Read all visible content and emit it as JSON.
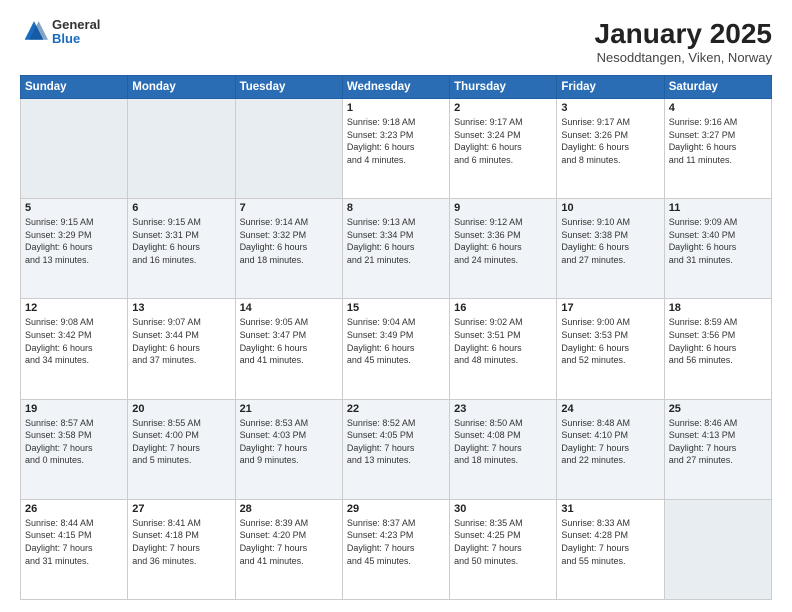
{
  "logo": {
    "general": "General",
    "blue": "Blue"
  },
  "title": "January 2025",
  "subtitle": "Nesoddtangen, Viken, Norway",
  "days_of_week": [
    "Sunday",
    "Monday",
    "Tuesday",
    "Wednesday",
    "Thursday",
    "Friday",
    "Saturday"
  ],
  "weeks": [
    [
      {
        "day": "",
        "info": ""
      },
      {
        "day": "",
        "info": ""
      },
      {
        "day": "",
        "info": ""
      },
      {
        "day": "1",
        "info": "Sunrise: 9:18 AM\nSunset: 3:23 PM\nDaylight: 6 hours\nand 4 minutes."
      },
      {
        "day": "2",
        "info": "Sunrise: 9:17 AM\nSunset: 3:24 PM\nDaylight: 6 hours\nand 6 minutes."
      },
      {
        "day": "3",
        "info": "Sunrise: 9:17 AM\nSunset: 3:26 PM\nDaylight: 6 hours\nand 8 minutes."
      },
      {
        "day": "4",
        "info": "Sunrise: 9:16 AM\nSunset: 3:27 PM\nDaylight: 6 hours\nand 11 minutes."
      }
    ],
    [
      {
        "day": "5",
        "info": "Sunrise: 9:15 AM\nSunset: 3:29 PM\nDaylight: 6 hours\nand 13 minutes."
      },
      {
        "day": "6",
        "info": "Sunrise: 9:15 AM\nSunset: 3:31 PM\nDaylight: 6 hours\nand 16 minutes."
      },
      {
        "day": "7",
        "info": "Sunrise: 9:14 AM\nSunset: 3:32 PM\nDaylight: 6 hours\nand 18 minutes."
      },
      {
        "day": "8",
        "info": "Sunrise: 9:13 AM\nSunset: 3:34 PM\nDaylight: 6 hours\nand 21 minutes."
      },
      {
        "day": "9",
        "info": "Sunrise: 9:12 AM\nSunset: 3:36 PM\nDaylight: 6 hours\nand 24 minutes."
      },
      {
        "day": "10",
        "info": "Sunrise: 9:10 AM\nSunset: 3:38 PM\nDaylight: 6 hours\nand 27 minutes."
      },
      {
        "day": "11",
        "info": "Sunrise: 9:09 AM\nSunset: 3:40 PM\nDaylight: 6 hours\nand 31 minutes."
      }
    ],
    [
      {
        "day": "12",
        "info": "Sunrise: 9:08 AM\nSunset: 3:42 PM\nDaylight: 6 hours\nand 34 minutes."
      },
      {
        "day": "13",
        "info": "Sunrise: 9:07 AM\nSunset: 3:44 PM\nDaylight: 6 hours\nand 37 minutes."
      },
      {
        "day": "14",
        "info": "Sunrise: 9:05 AM\nSunset: 3:47 PM\nDaylight: 6 hours\nand 41 minutes."
      },
      {
        "day": "15",
        "info": "Sunrise: 9:04 AM\nSunset: 3:49 PM\nDaylight: 6 hours\nand 45 minutes."
      },
      {
        "day": "16",
        "info": "Sunrise: 9:02 AM\nSunset: 3:51 PM\nDaylight: 6 hours\nand 48 minutes."
      },
      {
        "day": "17",
        "info": "Sunrise: 9:00 AM\nSunset: 3:53 PM\nDaylight: 6 hours\nand 52 minutes."
      },
      {
        "day": "18",
        "info": "Sunrise: 8:59 AM\nSunset: 3:56 PM\nDaylight: 6 hours\nand 56 minutes."
      }
    ],
    [
      {
        "day": "19",
        "info": "Sunrise: 8:57 AM\nSunset: 3:58 PM\nDaylight: 7 hours\nand 0 minutes."
      },
      {
        "day": "20",
        "info": "Sunrise: 8:55 AM\nSunset: 4:00 PM\nDaylight: 7 hours\nand 5 minutes."
      },
      {
        "day": "21",
        "info": "Sunrise: 8:53 AM\nSunset: 4:03 PM\nDaylight: 7 hours\nand 9 minutes."
      },
      {
        "day": "22",
        "info": "Sunrise: 8:52 AM\nSunset: 4:05 PM\nDaylight: 7 hours\nand 13 minutes."
      },
      {
        "day": "23",
        "info": "Sunrise: 8:50 AM\nSunset: 4:08 PM\nDaylight: 7 hours\nand 18 minutes."
      },
      {
        "day": "24",
        "info": "Sunrise: 8:48 AM\nSunset: 4:10 PM\nDaylight: 7 hours\nand 22 minutes."
      },
      {
        "day": "25",
        "info": "Sunrise: 8:46 AM\nSunset: 4:13 PM\nDaylight: 7 hours\nand 27 minutes."
      }
    ],
    [
      {
        "day": "26",
        "info": "Sunrise: 8:44 AM\nSunset: 4:15 PM\nDaylight: 7 hours\nand 31 minutes."
      },
      {
        "day": "27",
        "info": "Sunrise: 8:41 AM\nSunset: 4:18 PM\nDaylight: 7 hours\nand 36 minutes."
      },
      {
        "day": "28",
        "info": "Sunrise: 8:39 AM\nSunset: 4:20 PM\nDaylight: 7 hours\nand 41 minutes."
      },
      {
        "day": "29",
        "info": "Sunrise: 8:37 AM\nSunset: 4:23 PM\nDaylight: 7 hours\nand 45 minutes."
      },
      {
        "day": "30",
        "info": "Sunrise: 8:35 AM\nSunset: 4:25 PM\nDaylight: 7 hours\nand 50 minutes."
      },
      {
        "day": "31",
        "info": "Sunrise: 8:33 AM\nSunset: 4:28 PM\nDaylight: 7 hours\nand 55 minutes."
      },
      {
        "day": "",
        "info": ""
      }
    ]
  ]
}
